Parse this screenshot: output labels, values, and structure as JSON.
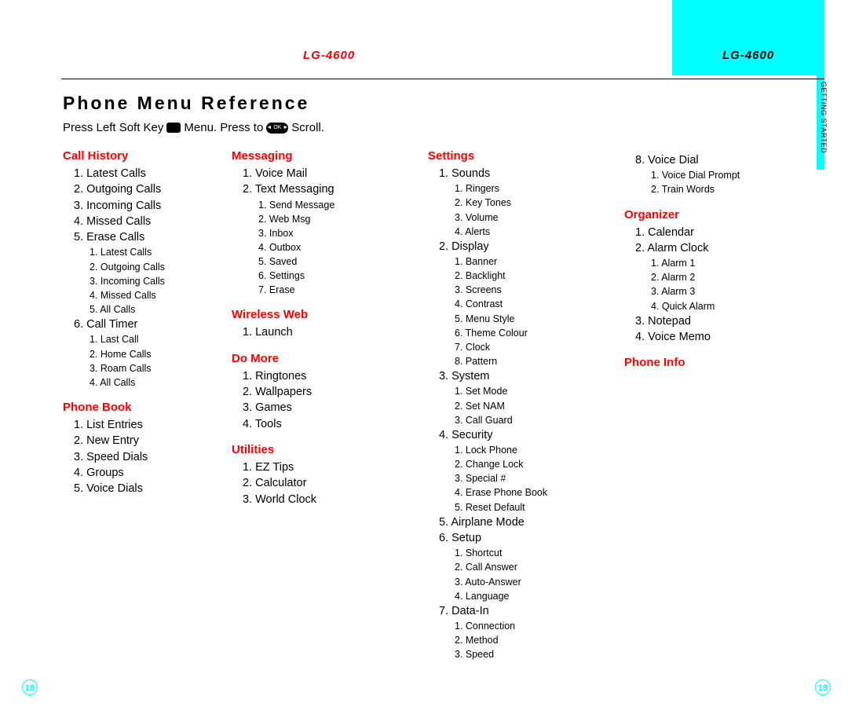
{
  "header_model": "LG-4600",
  "side_tab": "GETTING STARTED",
  "page_title": "Phone Menu Reference",
  "instruction_a": "Press Left Soft Key",
  "instruction_b": "Menu.  Press to",
  "instruction_c": "Scroll.",
  "page_left": "18",
  "page_right": "19",
  "col1": {
    "call_history": {
      "head": "Call History",
      "items": [
        "1. Latest Calls",
        "2. Outgoing Calls",
        "3. Incoming Calls",
        "4. Missed Calls",
        "5. Erase Calls"
      ],
      "erase_sub": [
        "1. Latest Calls",
        "2. Outgoing Calls",
        "3. Incoming Calls",
        "4. Missed Calls",
        "5. All Calls"
      ],
      "timer": "6. Call Timer",
      "timer_sub": [
        "1. Last Call",
        "2. Home Calls",
        "3. Roam Calls",
        "4. All Calls"
      ]
    },
    "phone_book": {
      "head": "Phone Book",
      "items": [
        "1. List Entries",
        "2. New Entry",
        "3. Speed Dials",
        "4. Groups",
        "5. Voice Dials"
      ]
    }
  },
  "col2": {
    "messaging": {
      "head": "Messaging",
      "items": [
        "1. Voice Mail",
        "2. Text Messaging"
      ],
      "tm_sub": [
        "1. Send Message",
        "2. Web Msg",
        "3. Inbox",
        "4. Outbox",
        "5. Saved",
        "6. Settings",
        "7. Erase"
      ]
    },
    "wireless": {
      "head": "Wireless Web",
      "items": [
        "1. Launch"
      ]
    },
    "domore": {
      "head": "Do More",
      "items": [
        "1. Ringtones",
        "2. Wallpapers",
        "3. Games",
        "4. Tools"
      ]
    },
    "utilities": {
      "head": "Utilities",
      "items": [
        "1. EZ Tips",
        "2. Calculator",
        "3. World Clock"
      ]
    }
  },
  "col3": {
    "settings": {
      "head": "Settings",
      "sounds": "1. Sounds",
      "sounds_sub": [
        "1. Ringers",
        "2. Key Tones",
        "3. Volume",
        "4. Alerts"
      ],
      "display": "2. Display",
      "display_sub": [
        "1. Banner",
        "2. Backlight",
        "3. Screens",
        "4. Contrast",
        "5. Menu Style",
        "6. Theme Colour",
        "7. Clock",
        "8. Pattern"
      ],
      "system": "3. System",
      "system_sub": [
        "1. Set Mode",
        "2. Set NAM",
        "3. Call Guard"
      ],
      "security": "4. Security",
      "security_sub": [
        "1. Lock Phone",
        "2. Change Lock",
        "3. Special #",
        "4. Erase Phone Book",
        "5. Reset Default"
      ],
      "airplane": "5. Airplane Mode",
      "setup": "6. Setup",
      "setup_sub": [
        "1. Shortcut",
        "2. Call Answer",
        "3. Auto-Answer",
        "4. Language"
      ],
      "datain": "7. Data-In",
      "datain_sub": [
        "1. Connection",
        "2. Method",
        "3. Speed"
      ]
    }
  },
  "col4": {
    "voicedial": "8. Voice Dial",
    "voicedial_sub": [
      "1. Voice Dial Prompt",
      "2. Train Words"
    ],
    "organizer": {
      "head": "Organizer",
      "items_a": [
        "1. Calendar",
        "2. Alarm Clock"
      ],
      "alarm_sub": [
        "1. Alarm 1",
        "2. Alarm 2",
        "3. Alarm 3",
        "4. Quick Alarm"
      ],
      "items_b": [
        "3. Notepad",
        "4. Voice Memo"
      ]
    },
    "phoneinfo": {
      "head": "Phone Info"
    }
  }
}
